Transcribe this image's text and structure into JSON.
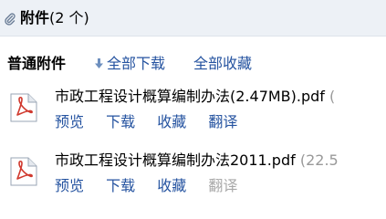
{
  "header": {
    "title": "附件",
    "count": "(2 个)"
  },
  "section": {
    "label": "普通附件",
    "download_all": "全部下载",
    "save_all": "全部收藏"
  },
  "files": [
    {
      "name": "市政工程设计概算编制办法(2.47MB).pdf",
      "size": "(",
      "actions": {
        "preview": "预览",
        "download": "下载",
        "save": "收藏",
        "translate": "翻译"
      }
    },
    {
      "name": "市政工程设计概算编制办法2011.pdf",
      "size": "(22.5",
      "actions": {
        "preview": "预览",
        "download": "下载",
        "save": "收藏",
        "translate": "翻译"
      }
    }
  ],
  "colors": {
    "link": "#2553a0",
    "header_bg": "#edf1f6",
    "muted": "#999999",
    "pdf_red": "#d0392e"
  },
  "icons": {
    "header": "paperclip-icon",
    "download_all": "download-arrow-icon",
    "file": "pdf-file-icon"
  }
}
